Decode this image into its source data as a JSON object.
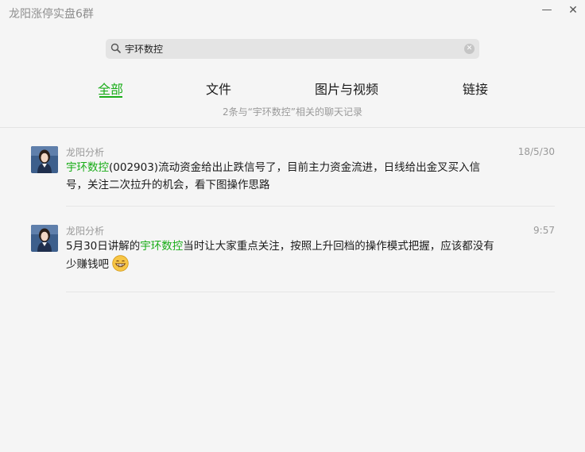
{
  "window": {
    "title": "龙阳涨停实盘6群",
    "minimize_label": "—",
    "close_label": "✕"
  },
  "search": {
    "value": "宇环数控",
    "clear_label": "✕"
  },
  "tabs": [
    {
      "label": "全部",
      "active": true
    },
    {
      "label": "文件",
      "active": false
    },
    {
      "label": "图片与视频",
      "active": false
    },
    {
      "label": "链接",
      "active": false
    }
  ],
  "summary": "2条与“宇环数控”相关的聊天记录",
  "messages": [
    {
      "sender": "龙阳分析",
      "time": "18/5/30",
      "prefix": "",
      "keyword": "宇环数控",
      "suffix": "(002903)流动资金给出止跌信号了，目前主力资金流进，日线给出金叉买入信号，关注二次拉升的机会，看下图操作思路"
    },
    {
      "sender": "龙阳分析",
      "time": "9:57",
      "prefix": "5月30日讲解的",
      "keyword": "宇环数控",
      "suffix": "当时让大家重点关注，按照上升回档的操作模式把握，应该都没有少赚钱吧"
    }
  ],
  "colors": {
    "accent": "#1aad19",
    "muted": "#999999"
  }
}
